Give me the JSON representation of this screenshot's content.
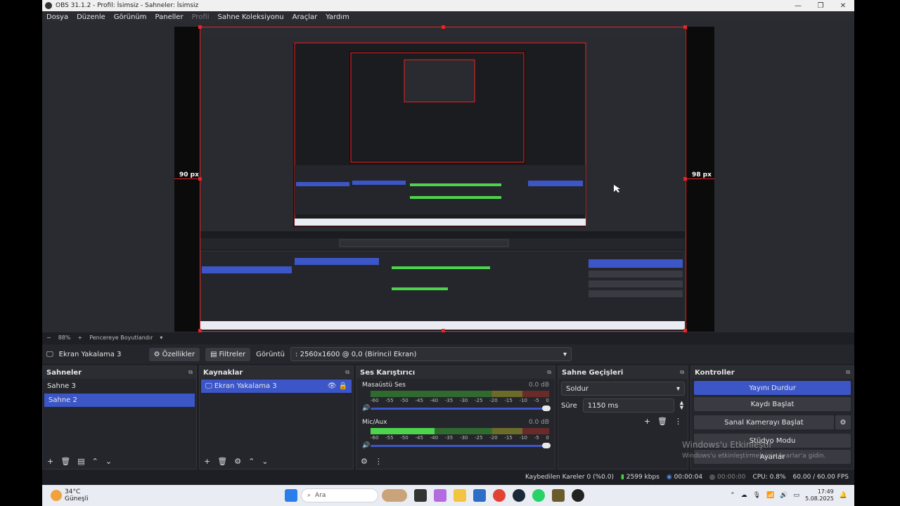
{
  "window": {
    "title": "OBS 31.1.2 - Profil: İsimsiz - Sahneler: İsimsiz"
  },
  "menu": [
    "Dosya",
    "Düzenle",
    "Görünüm",
    "Paneller",
    "Profil",
    "Sahne Koleksiyonu",
    "Araçlar",
    "Yardım"
  ],
  "preview": {
    "left_margin": "90 px",
    "right_margin": "98 px"
  },
  "zoom": {
    "minus": "−",
    "value": "88%",
    "plus": "+",
    "fit": "Pencereye Boyutlandır"
  },
  "source_bar": {
    "source_name": "Ekran Yakalama 3",
    "properties": "Özellikler",
    "filters": "Filtreler",
    "display_label": "Görüntü",
    "display_value": ": 2560x1600 @ 0,0 (Birincil Ekran)"
  },
  "scenes": {
    "title": "Sahneler",
    "items": [
      "Sahne 3",
      "Sahne 2"
    ],
    "selected": 1
  },
  "sources": {
    "title": "Kaynaklar",
    "items": [
      "Ekran Yakalama 3"
    ]
  },
  "mixer": {
    "title": "Ses Karıştırıcı",
    "channels": [
      {
        "name": "Masaüstü Ses",
        "db": "0.0 dB",
        "level": 0.0
      },
      {
        "name": "Mic/Aux",
        "db": "0.0 dB",
        "level": 0.36
      }
    ],
    "ticks": [
      "-60",
      "-55",
      "-50",
      "-45",
      "-40",
      "-35",
      "-30",
      "-25",
      "-20",
      "-15",
      "-10",
      "-5",
      "0"
    ]
  },
  "transitions": {
    "title": "Sahne Geçişleri",
    "type": "Soldur",
    "duration_label": "Süre",
    "duration": "1150 ms"
  },
  "controls": {
    "title": "Kontroller",
    "stop_stream": "Yayını Durdur",
    "start_record": "Kaydı Başlat",
    "virtual_cam": "Sanal Kamerayı Başlat",
    "studio_mode": "Stüdyo Modu",
    "settings": "Ayarlar"
  },
  "watermark": {
    "line1": "Windows'u Etkinleştir",
    "line2": "Windows'u etkinleştirmek için Ayarlar'a gidin."
  },
  "status": {
    "dropped": "Kaybedilen Kareler 0 (%0.0)",
    "bitrate": "2599 kbps",
    "stream_time": "00:00:04",
    "rec_time": "00:00:00",
    "cpu": "CPU: 0.8%",
    "fps": "60.00 / 60.00 FPS"
  },
  "taskbar": {
    "temp": "34°C",
    "weather": "Güneşli",
    "search": "Ara",
    "time": "17:49",
    "date": "5.08.2025"
  },
  "colors": {
    "accent": "#3c56c8",
    "border_red": "#ee2222"
  }
}
